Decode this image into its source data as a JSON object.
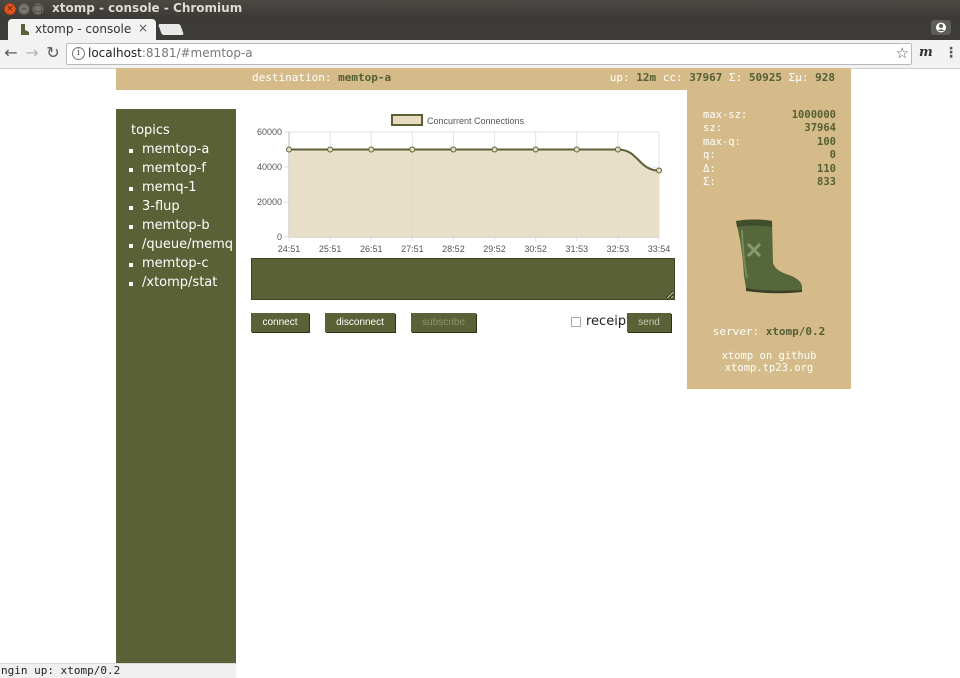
{
  "window": {
    "title": "xtomp - console - Chromium"
  },
  "tab": {
    "title": "xtomp - console",
    "close": "×"
  },
  "toolbar": {
    "url_host": "localhost",
    "url_rest": ":8181/#memtop-a",
    "ext_label": "m",
    "menu": "⋮",
    "star": "☆",
    "back": "←",
    "forward": "→",
    "reload": "↻",
    "info": "i"
  },
  "header": {
    "destination_label": "destination:",
    "destination": "memtop-a",
    "up_label": "up:",
    "up": "12m",
    "cc_label": "cc:",
    "cc": "37967",
    "sigma_label": "Σ:",
    "sigma": "50925",
    "sigma_mu_label": "Σμ:",
    "sigma_mu": "928"
  },
  "sidebar": {
    "title": "topics",
    "items": [
      "memtop-a",
      "memtop-f",
      "memq-1",
      "3-flup",
      "memtop-b",
      "/queue/memq",
      "memtop-c",
      "/xtomp/stat"
    ]
  },
  "chart_data": {
    "type": "area",
    "series": [
      {
        "name": "Concurrent Connections",
        "values": [
          50000,
          50000,
          50000,
          50000,
          50000,
          50000,
          50000,
          50000,
          50000,
          38000
        ]
      }
    ],
    "x": [
      "24:51",
      "25:51",
      "26:51",
      "27:51",
      "28:52",
      "29:52",
      "30:52",
      "31:53",
      "32:53",
      "33:54"
    ],
    "ylim": [
      0,
      60000
    ],
    "yticks": [
      0,
      20000,
      40000,
      60000
    ],
    "ytick_labels": [
      "0",
      "20000",
      "40000",
      "60000"
    ],
    "legend": "top",
    "grid": true,
    "colors": {
      "line": "#5b6136",
      "fill": "#e6dcc2"
    }
  },
  "controls": {
    "connect": "connect",
    "disconnect": "disconnect",
    "subscribe": "subscribe",
    "receipt": "receipt",
    "send": "send"
  },
  "stats": [
    {
      "key": "max-sz:",
      "value": "1000000"
    },
    {
      "key": "sz:",
      "value": "37964"
    },
    {
      "key": "max-q:",
      "value": "100"
    },
    {
      "key": "q:",
      "value": "0"
    },
    {
      "key": "Δ:",
      "value": "110"
    },
    {
      "key": "Σ:",
      "value": "833"
    }
  ],
  "server": {
    "label": "server:",
    "value": "xtomp/0.2"
  },
  "links": {
    "github": "xtomp on github",
    "site": "xtomp.tp23.org"
  },
  "statusbar": {
    "text": "ngin up: xtomp/0.2"
  },
  "icons": {
    "favicon": "boot-icon",
    "profile": "profile-icon",
    "mascot": "boot-icon"
  },
  "colors": {
    "olive": "#5b6136",
    "tan": "#d4bb89"
  }
}
